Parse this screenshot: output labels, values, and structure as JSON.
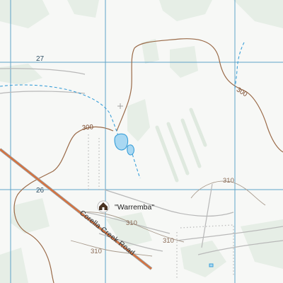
{
  "map": {
    "grid_labels": {
      "easting": "27",
      "northing": "26"
    },
    "contour_labels": {
      "c300_east": "300",
      "c300_west": "300",
      "c310_east": "310",
      "c310_mid_a": "310",
      "c310_mid_b": "310",
      "c310_south": "310"
    },
    "road_name": "Corella Creek Road",
    "homestead_name": "\"Warremba\"",
    "colors": {
      "background": "#f7f8f6",
      "vegetation": "#e4ede4",
      "contour": "#9a6a48",
      "contour_faint": "#a89a8c",
      "grid": "#5fa3c8",
      "water": "#3a9fd8",
      "water_fill": "#a9d8f2",
      "road": "#d9703a",
      "track": "#b5b5b5"
    },
    "icons": [
      "homestead-icon",
      "tank-icon",
      "spot-height-icon"
    ]
  }
}
